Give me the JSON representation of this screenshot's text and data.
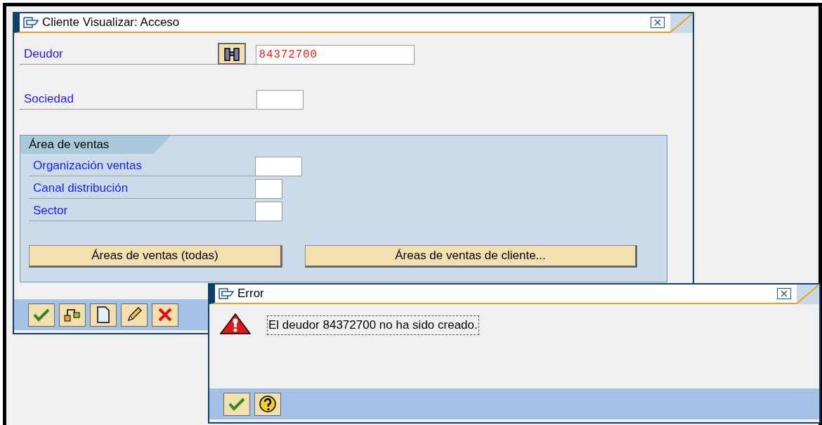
{
  "main_window": {
    "title": "Cliente Visualizar: Acceso",
    "fields": [
      {
        "label": "Deudor",
        "value": "84372700",
        "error": true,
        "search_help": true
      },
      {
        "label": "Sociedad",
        "search_help": false
      }
    ],
    "group": {
      "title": "Área de ventas",
      "fields": [
        {
          "label": "Organización ventas"
        },
        {
          "label": "Canal distribución"
        },
        {
          "label": "Sector"
        }
      ],
      "buttons": [
        "Áreas de ventas (todas)",
        "Áreas de ventas de cliente..."
      ]
    },
    "toolbar": [
      {
        "kind": "check"
      },
      {
        "kind": "switch"
      },
      {
        "kind": "new"
      },
      {
        "kind": "edit"
      },
      {
        "kind": "cancel"
      }
    ]
  },
  "error_dialog": {
    "title": "Error",
    "message": "El deudor 84372700 no ha sido creado.",
    "toolbar": [
      {
        "kind": "check"
      },
      {
        "kind": "help"
      }
    ]
  }
}
